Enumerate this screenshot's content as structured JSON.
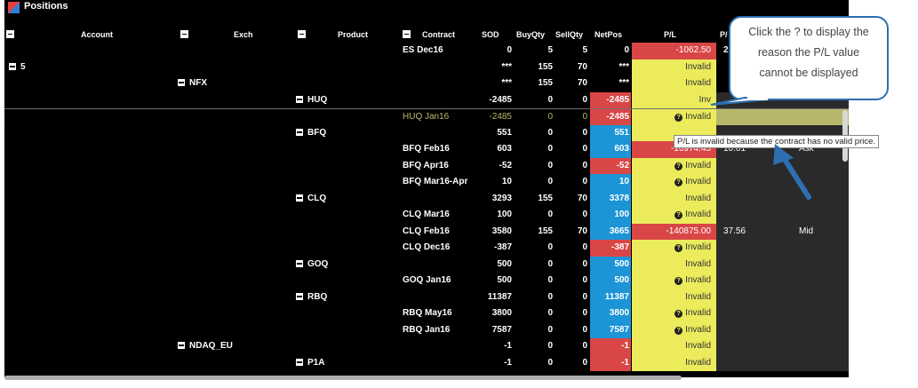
{
  "window": {
    "title": "Positions"
  },
  "columns": [
    "Account",
    "Exch",
    "Product",
    "Contract",
    "SOD",
    "BuyQty",
    "SellQty",
    "NetPos",
    "P/L",
    "P/"
  ],
  "rows": [
    {
      "level": 3,
      "label": "",
      "contract": "ES Dec16",
      "sod": "0",
      "buy": "5",
      "sell": "5",
      "net": "0",
      "net_sign": "neg",
      "pl": "-1062.50",
      "pl_kind": "red",
      "x1": "2",
      "x2": ""
    },
    {
      "level": 0,
      "label": "5",
      "contract": "",
      "sod": "***",
      "buy": "155",
      "sell": "70",
      "net": "***",
      "net_sign": "none",
      "pl": "Invalid",
      "pl_kind": "plain",
      "x1": "",
      "x2": ""
    },
    {
      "level": 1,
      "label": "NFX",
      "contract": "",
      "sod": "***",
      "buy": "155",
      "sell": "70",
      "net": "***",
      "net_sign": "none",
      "pl": "Invalid",
      "pl_kind": "plain",
      "x1": "",
      "x2": ""
    },
    {
      "level": 2,
      "label": "HUQ",
      "contract": "",
      "sod": "-2485",
      "buy": "0",
      "sell": "0",
      "net": "-2485",
      "net_sign": "neg",
      "pl": "Inv",
      "pl_kind": "plain",
      "x1": "",
      "x2": ""
    },
    {
      "level": 3,
      "label": "",
      "contract": "HUQ Jan16",
      "sod": "-2485",
      "buy": "0",
      "sell": "0",
      "net": "-2485",
      "net_sign": "neg",
      "pl": "Invalid",
      "pl_kind": "q",
      "x1": "",
      "x2": "",
      "selected": true
    },
    {
      "level": 2,
      "label": "BFQ",
      "contract": "",
      "sod": "551",
      "buy": "0",
      "sell": "0",
      "net": "551",
      "net_sign": "pos",
      "pl": "",
      "pl_kind": "plain",
      "x1": "",
      "x2": ""
    },
    {
      "level": 3,
      "label": "",
      "contract": "BFQ Feb16",
      "sod": "603",
      "buy": "0",
      "sell": "0",
      "net": "603",
      "net_sign": "pos",
      "pl": "-16974.45",
      "pl_kind": "red",
      "x1": "10.01",
      "x2": "Ask"
    },
    {
      "level": 3,
      "label": "",
      "contract": "BFQ Apr16",
      "sod": "-52",
      "buy": "0",
      "sell": "0",
      "net": "-52",
      "net_sign": "neg",
      "pl": "Invalid",
      "pl_kind": "q",
      "x1": "",
      "x2": ""
    },
    {
      "level": 3,
      "label": "",
      "contract": "BFQ Mar16-Apr",
      "sod": "10",
      "buy": "0",
      "sell": "0",
      "net": "10",
      "net_sign": "pos",
      "pl": "Invalid",
      "pl_kind": "q",
      "x1": "",
      "x2": ""
    },
    {
      "level": 2,
      "label": "CLQ",
      "contract": "",
      "sod": "3293",
      "buy": "155",
      "sell": "70",
      "net": "3378",
      "net_sign": "pos",
      "pl": "Invalid",
      "pl_kind": "plain",
      "x1": "",
      "x2": ""
    },
    {
      "level": 3,
      "label": "",
      "contract": "CLQ Mar16",
      "sod": "100",
      "buy": "0",
      "sell": "0",
      "net": "100",
      "net_sign": "pos",
      "pl": "Invalid",
      "pl_kind": "q",
      "x1": "",
      "x2": ""
    },
    {
      "level": 3,
      "label": "",
      "contract": "CLQ Feb16",
      "sod": "3580",
      "buy": "155",
      "sell": "70",
      "net": "3665",
      "net_sign": "pos",
      "pl": "-140875.00",
      "pl_kind": "red",
      "x1": "37.56",
      "x2": "Mid"
    },
    {
      "level": 3,
      "label": "",
      "contract": "CLQ Dec16",
      "sod": "-387",
      "buy": "0",
      "sell": "0",
      "net": "-387",
      "net_sign": "neg",
      "pl": "Invalid",
      "pl_kind": "q",
      "x1": "",
      "x2": ""
    },
    {
      "level": 2,
      "label": "GOQ",
      "contract": "",
      "sod": "500",
      "buy": "0",
      "sell": "0",
      "net": "500",
      "net_sign": "pos",
      "pl": "Invalid",
      "pl_kind": "plain",
      "x1": "",
      "x2": ""
    },
    {
      "level": 3,
      "label": "",
      "contract": "GOQ Jan16",
      "sod": "500",
      "buy": "0",
      "sell": "0",
      "net": "500",
      "net_sign": "pos",
      "pl": "Invalid",
      "pl_kind": "q",
      "x1": "",
      "x2": ""
    },
    {
      "level": 2,
      "label": "RBQ",
      "contract": "",
      "sod": "11387",
      "buy": "0",
      "sell": "0",
      "net": "11387",
      "net_sign": "pos",
      "pl": "Invalid",
      "pl_kind": "plain",
      "x1": "",
      "x2": ""
    },
    {
      "level": 3,
      "label": "",
      "contract": "RBQ May16",
      "sod": "3800",
      "buy": "0",
      "sell": "0",
      "net": "3800",
      "net_sign": "pos",
      "pl": "Invalid",
      "pl_kind": "q",
      "x1": "",
      "x2": ""
    },
    {
      "level": 3,
      "label": "",
      "contract": "RBQ Jan16",
      "sod": "7587",
      "buy": "0",
      "sell": "0",
      "net": "7587",
      "net_sign": "pos",
      "pl": "Invalid",
      "pl_kind": "q",
      "x1": "",
      "x2": ""
    },
    {
      "level": 1,
      "label": "NDAQ_EU",
      "contract": "",
      "sod": "-1",
      "buy": "0",
      "sell": "0",
      "net": "-1",
      "net_sign": "neg",
      "pl": "Invalid",
      "pl_kind": "plain",
      "x1": "",
      "x2": ""
    },
    {
      "level": 2,
      "label": "P1A",
      "contract": "",
      "sod": "-1",
      "buy": "0",
      "sell": "0",
      "net": "-1",
      "net_sign": "neg",
      "pl": "Invalid",
      "pl_kind": "plain",
      "x1": "",
      "x2": ""
    }
  ],
  "callout": {
    "line1": "Click the ? to display the",
    "line2": "reason the P/L value",
    "line3": "cannot be displayed"
  },
  "tooltip": "P/L is invalid because the contract has no valid price.",
  "colors": {
    "netpos_pos": "#1d94d6",
    "netpos_neg": "#d94646",
    "pl_invalid": "#ebeb5c",
    "pl_loss": "#d94646",
    "callout_border": "#2d6fb0"
  }
}
